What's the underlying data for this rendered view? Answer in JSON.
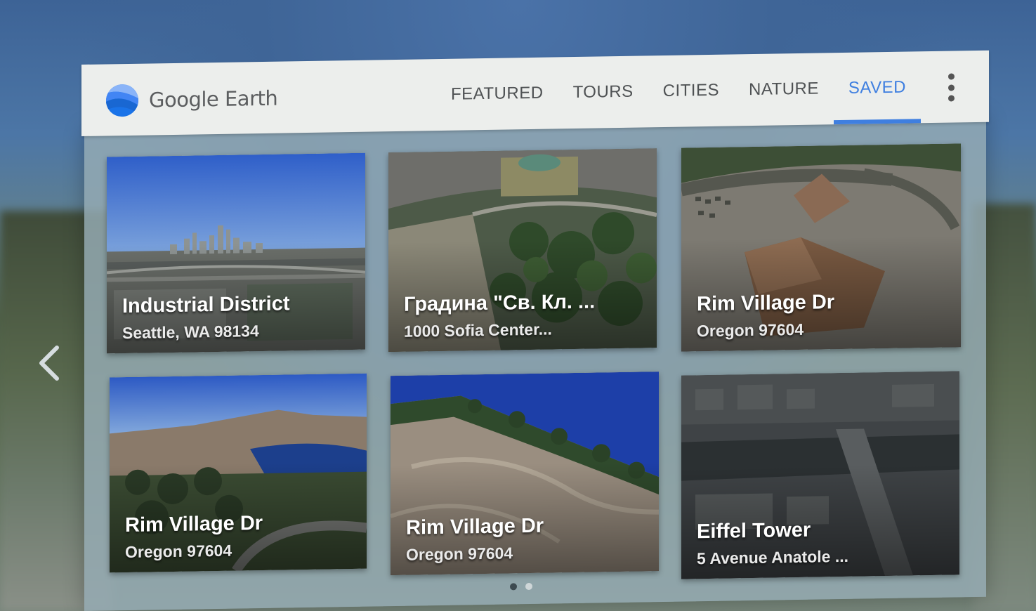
{
  "app": {
    "name": "Google Earth",
    "logo_icon": "google-earth-logo-icon",
    "accent_color": "#3f7fe0"
  },
  "tabs": [
    {
      "label": "FEATURED",
      "active": false
    },
    {
      "label": "TOURS",
      "active": false
    },
    {
      "label": "CITIES",
      "active": false
    },
    {
      "label": "NATURE",
      "active": false
    },
    {
      "label": "SAVED",
      "active": true
    }
  ],
  "menu_icon": "more-vert-icon",
  "nav": {
    "back_icon": "chevron-left-icon"
  },
  "cards": [
    {
      "title": "Industrial District",
      "subtitle": "Seattle, WA 98134"
    },
    {
      "title": "Градина \"Св. Кл. ...",
      "subtitle": "1000 Sofia Center..."
    },
    {
      "title": "Rim Village Dr",
      "subtitle": "Oregon 97604"
    },
    {
      "title": "Rim Village Dr",
      "subtitle": "Oregon 97604"
    },
    {
      "title": "Rim Village Dr",
      "subtitle": "Oregon 97604"
    },
    {
      "title": "Eiffel Tower",
      "subtitle": "5 Avenue Anatole ..."
    }
  ],
  "pagination": {
    "pages": 2,
    "current": 1
  }
}
